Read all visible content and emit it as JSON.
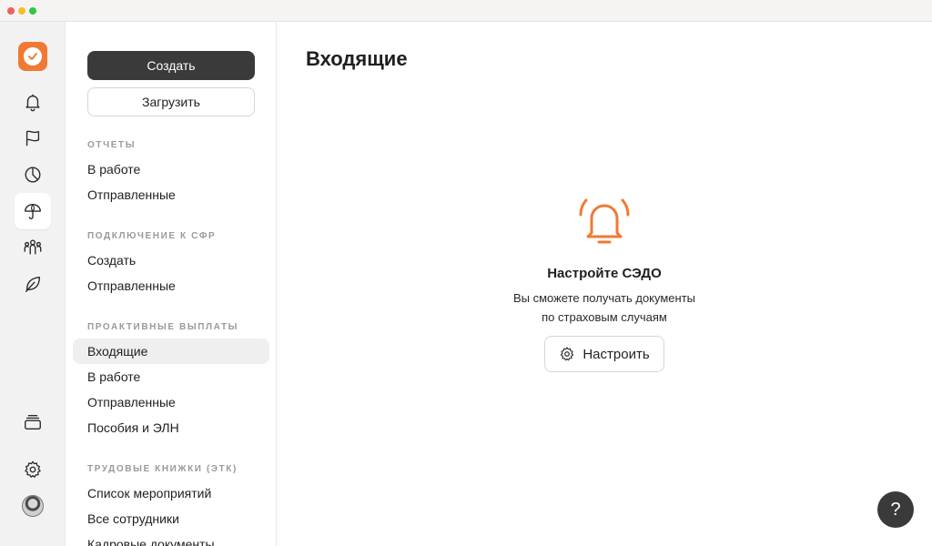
{
  "rail": {
    "icons": [
      "check-logo-icon",
      "bell-icon",
      "flag-icon",
      "pie-chart-icon",
      "umbrella-icon",
      "people-icon",
      "leaf-icon",
      "archive-icon",
      "gear-icon",
      "avatar"
    ]
  },
  "sidebar": {
    "create_label": "Создать",
    "upload_label": "Загрузить",
    "sections": [
      {
        "title": "ОТЧЕТЫ",
        "items": [
          "В работе",
          "Отправленные"
        ]
      },
      {
        "title": "ПОДКЛЮЧЕНИЕ К СФР",
        "items": [
          "Создать",
          "Отправленные"
        ]
      },
      {
        "title": "ПРОАКТИВНЫЕ ВЫПЛАТЫ",
        "items": [
          "Входящие",
          "В работе",
          "Отправленные",
          "Пособия и ЭЛН"
        ]
      },
      {
        "title": "ТРУДОВЫЕ КНИЖКИ (ЭТК)",
        "items": [
          "Список мероприятий",
          "Все сотрудники",
          "Кадровые документы"
        ]
      }
    ],
    "active_item": "Входящие"
  },
  "main": {
    "title": "Входящие",
    "empty_title": "Настройте СЭДО",
    "empty_line1": "Вы сможете получать документы",
    "empty_line2": "по страховым случаям",
    "setup_label": "Настроить"
  },
  "help_label": "?",
  "colors": {
    "accent": "#f07a33",
    "dark_button": "#3a3a3a",
    "active_bg": "#efefef"
  }
}
